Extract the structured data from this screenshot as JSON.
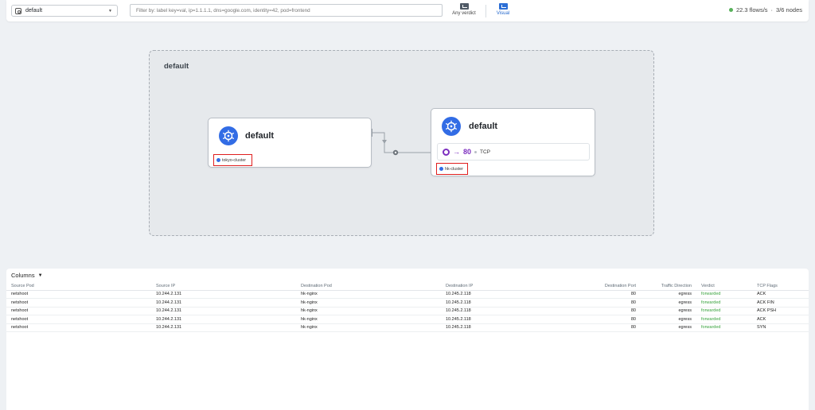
{
  "topbar": {
    "namespace": "default",
    "filter_placeholder": "Filter by: label key=val, ip=1.1.1.1, dns=google.com, identity=42, pod=frontend",
    "verdict_label": "Any verdict",
    "visual_label": "Visual",
    "flows_rate": "22.3 flows/s",
    "separator": "·",
    "nodes": "3/6 nodes"
  },
  "graph": {
    "namespace_label": "default",
    "source_card": {
      "title": "default",
      "cluster": "tokyo-cluster"
    },
    "dest_card": {
      "title": "default",
      "cluster": "hk-cluster",
      "port": "80",
      "protocol": "TCP",
      "arrow": "→"
    }
  },
  "flows": {
    "columns_label": "Columns",
    "headers": [
      "Source Pod",
      "Source IP",
      "Destination Pod",
      "Destination IP",
      "Destination Port",
      "Traffic Direction",
      "Verdict",
      "TCP Flags"
    ],
    "rows": [
      [
        "netshoot",
        "10.244.2.131",
        "hk-nginx",
        "10.245.2.118",
        "80",
        "egress",
        "forwarded",
        "ACK"
      ],
      [
        "netshoot",
        "10.244.2.131",
        "hk-nginx",
        "10.245.2.118",
        "80",
        "egress",
        "forwarded",
        "ACK FIN"
      ],
      [
        "netshoot",
        "10.244.2.131",
        "hk-nginx",
        "10.245.2.118",
        "80",
        "egress",
        "forwarded",
        "ACK PSH"
      ],
      [
        "netshoot",
        "10.244.2.131",
        "hk-nginx",
        "10.245.2.118",
        "80",
        "egress",
        "forwarded",
        "ACK"
      ],
      [
        "netshoot",
        "10.244.2.131",
        "hk-nginx",
        "10.245.2.118",
        "80",
        "egress",
        "forwarded",
        "SYN"
      ]
    ]
  },
  "colors": {
    "accent": "#2c6ed5",
    "port": "#7c2fbf",
    "verdict_forwarded": "#3aa33f",
    "cluster_highlight": "#e01e1e",
    "k8s_blue": "#326ce5"
  }
}
